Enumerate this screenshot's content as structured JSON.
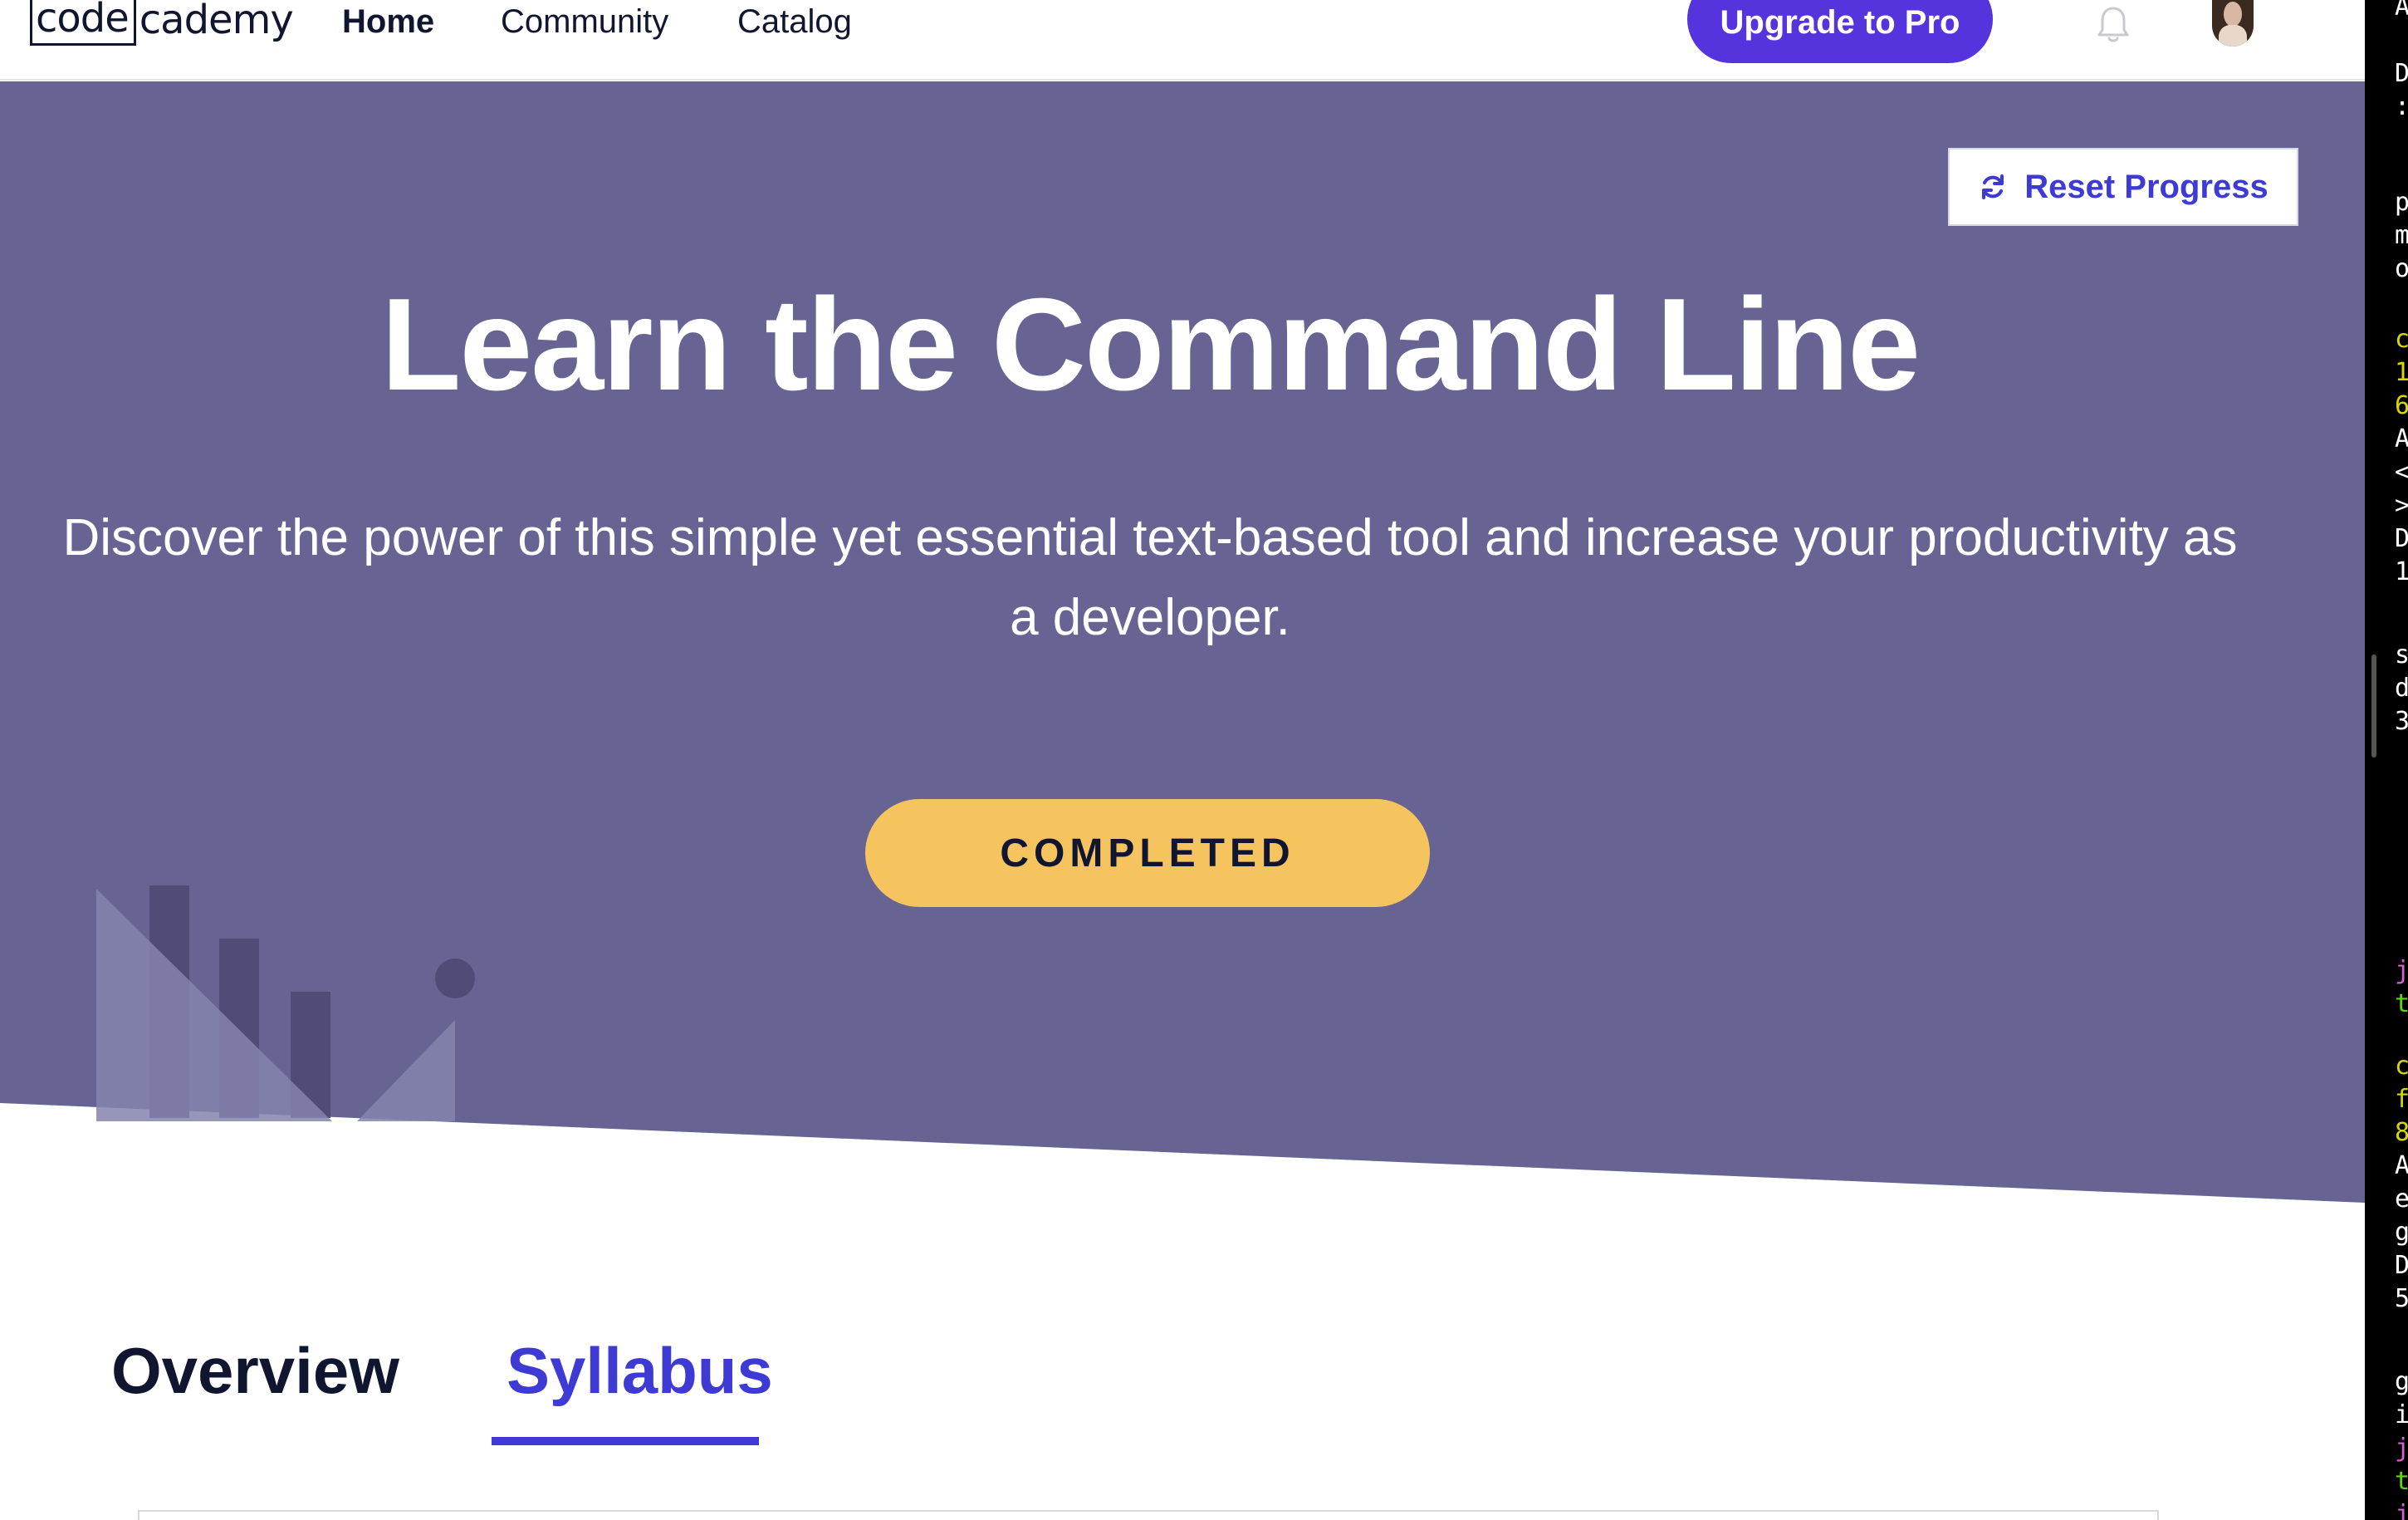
{
  "nav": {
    "logo_box": "code",
    "logo_rest": "cademy",
    "links": [
      "Home",
      "Community",
      "Catalog"
    ],
    "upgrade_label": "Upgrade to Pro"
  },
  "hero": {
    "reset_label": "Reset Progress",
    "title": "Learn the Command Line",
    "subtitle_line1": "Discover the power of this simple yet essential text-based tool and increase your productivity as",
    "subtitle_line2": "a developer.",
    "status_button": "COMPLETED"
  },
  "tabs": [
    "Overview",
    "Syllabus"
  ],
  "active_tab": "Syllabus",
  "terminal": {
    "lines": [
      {
        "text": "A",
        "color": "#ffffff"
      },
      {
        "text": "D",
        "color": "#ffffff"
      },
      {
        "text": ":",
        "color": "#ffffff"
      },
      {
        "text": "p",
        "color": "#ffffff"
      },
      {
        "text": "m",
        "color": "#ffffff"
      },
      {
        "text": "o",
        "color": "#ffffff"
      },
      {
        "text": "c",
        "color": "#d7d700"
      },
      {
        "text": "1",
        "color": "#d7d700"
      },
      {
        "text": "6",
        "color": "#d7d700"
      },
      {
        "text": "A",
        "color": "#ffffff"
      },
      {
        "text": "<",
        "color": "#ffffff"
      },
      {
        "text": ">",
        "color": "#ffffff"
      },
      {
        "text": "D",
        "color": "#ffffff"
      },
      {
        "text": "1",
        "color": "#ffffff"
      },
      {
        "text": "s",
        "color": "#ffffff"
      },
      {
        "text": "d",
        "color": "#ffffff"
      },
      {
        "text": "3",
        "color": "#ffffff"
      },
      {
        "text": "j",
        "color": "#d75fd7"
      },
      {
        "text": "t",
        "color": "#5fd700"
      },
      {
        "text": "c",
        "color": "#d7d700"
      },
      {
        "text": "f",
        "color": "#d7d700"
      },
      {
        "text": "8",
        "color": "#d7d700"
      },
      {
        "text": "A",
        "color": "#ffffff"
      },
      {
        "text": "e",
        "color": "#ffffff"
      },
      {
        "text": "g",
        "color": "#ffffff"
      },
      {
        "text": "D",
        "color": "#ffffff"
      },
      {
        "text": "5",
        "color": "#ffffff"
      },
      {
        "text": "g",
        "color": "#ffffff"
      },
      {
        "text": "i",
        "color": "#ffffff"
      },
      {
        "text": "j",
        "color": "#d75fd7"
      },
      {
        "text": "t",
        "color": "#5fd700"
      },
      {
        "text": "j",
        "color": "#d75fd7"
      }
    ]
  },
  "colors": {
    "brand": "#5533dd",
    "hero_bg": "#676494",
    "accent_link": "#3e3ad4",
    "completed_bg": "#f5c45e"
  },
  "icons": {
    "bell": "bell-icon",
    "reset": "refresh-icon",
    "avatar": "avatar"
  }
}
